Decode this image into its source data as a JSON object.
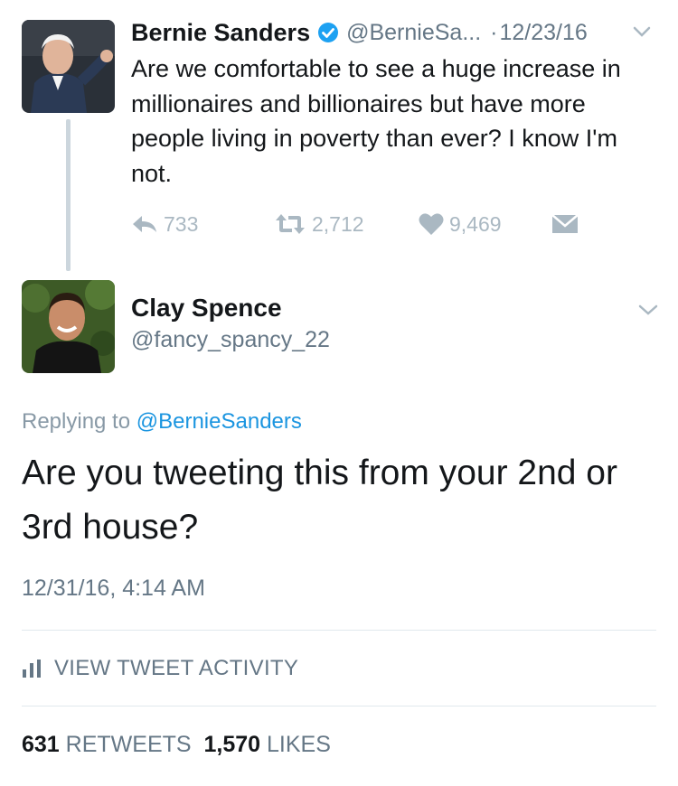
{
  "tweet": {
    "author_name": "Bernie Sanders",
    "author_handle": "@BernieSa...",
    "dot": "·",
    "date": "12/23/16",
    "text": "Are we comfortable to see a huge increase in millionaires and billionaires but have more people living in poverty than ever? I know I'm not.",
    "reply_count": "733",
    "retweet_count": "2,712",
    "like_count": "9,469",
    "icons": [
      "verified-badge-icon",
      "chevron-down-icon",
      "reply-icon",
      "retweet-icon",
      "heart-icon",
      "direct-message-icon"
    ]
  },
  "reply": {
    "author_name": "Clay Spence",
    "author_handle": "@fancy_spancy_22",
    "replying_prefix": "Replying to",
    "replying_mention": "@BernieSanders",
    "text": "Are you tweeting this from your 2nd or 3rd house?",
    "timestamp": "12/31/16, 4:14 AM",
    "activity_label": "VIEW TWEET ACTIVITY",
    "retweets_count": "631",
    "retweets_label": "RETWEETS",
    "likes_count": "1,570",
    "likes_label": "LIKES"
  },
  "colors": {
    "accent": "#1da1f2",
    "mention": "#1b95e0",
    "muted": "#657786",
    "icon_gray": "#aab8c2",
    "text": "#14171a"
  }
}
